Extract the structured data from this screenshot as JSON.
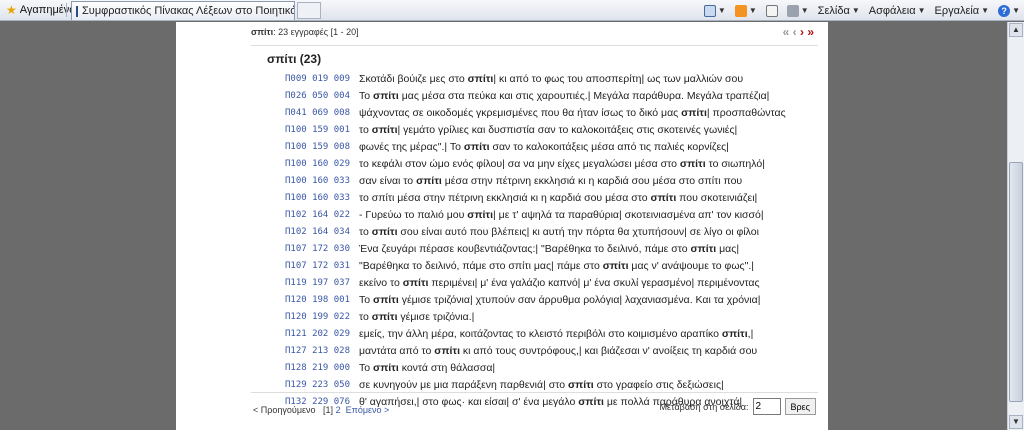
{
  "browser": {
    "favorites_label": "Αγαπημένα",
    "tab_title": "Συμφραστικός Πίνακας Λέξεων στο Ποιητικό Έργο το...",
    "tools": {
      "page": "Σελίδα",
      "safety": "Ασφάλεια",
      "tools": "Εργαλεία"
    }
  },
  "results": {
    "term": "σπίτι",
    "count_text": ": 23 εγγραφές [1 - 20]",
    "heading": "σπίτι (23)",
    "rows": [
      {
        "ref": "Π009 019 009",
        "before": "Σκοτάδι βούιζε μες στο ",
        "word": "σπίτι",
        "after": "| κι από το φως του αποσπερίτη| ως των μαλλιών σου"
      },
      {
        "ref": "Π026 050 004",
        "before": "Το ",
        "word": "σπίτι",
        "after": " μας μέσα στα πεύκα και στις χαρουπιές.| Μεγάλα παράθυρα. Μεγάλα τραπέζια|"
      },
      {
        "ref": "Π041 069 008",
        "before": "ψάχνοντας σε οικοδομές γκρεμισμένες που θα ήταν ίσως το δικό μας ",
        "word": "σπίτι",
        "after": "| προσπαθώντας"
      },
      {
        "ref": "Π100 159 001",
        "before": "το ",
        "word": "σπίτι",
        "after": "| γεμάτο γρίλιες και δυσπιστία σαν το καλοκοιτάξεις στις σκοτεινές γωνιές|"
      },
      {
        "ref": "Π100 159 008",
        "before": "φωνές της μέρας\".| Το ",
        "word": "σπίτι",
        "after": " σαν το καλοκοιτάξεις μέσα από τις παλιές κορνίζες|"
      },
      {
        "ref": "Π100 160 029",
        "before": "το κεφάλι στον ώμο ενός φίλου| σα να μην είχες μεγαλώσει μέσα στο ",
        "word": "σπίτι",
        "after": " το σιωπηλό|"
      },
      {
        "ref": "Π100 160 033",
        "before": "σαν είναι το ",
        "word": "σπίτι",
        "after": " μέσα στην πέτρινη εκκλησιά κι η καρδιά σου μέσα στο σπίτι που"
      },
      {
        "ref": "Π100 160 033",
        "before": "το σπίτι μέσα στην πέτρινη εκκλησιά κι η καρδιά σου μέσα στο ",
        "word": "σπίτι",
        "after": " που σκοτεινιάζει|"
      },
      {
        "ref": "Π102 164 022",
        "before": "- Γυρεύω το παλιό μου ",
        "word": "σπίτι",
        "after": "| με τ' αψηλά τα παραθύρια| σκοτεινιασμένα απ' τον κισσό|"
      },
      {
        "ref": "Π102 164 034",
        "before": "το ",
        "word": "σπίτι",
        "after": " σου είναι αυτό που βλέπεις| κι αυτή την πόρτα θα χτυπήσουν| σε λίγο οι φίλοι"
      },
      {
        "ref": "Π107 172 030",
        "before": "Ένα ζευγάρι πέρασε κουβεντιάζοντας:| \"Βαρέθηκα το δειλινό, πάμε στο ",
        "word": "σπίτι",
        "after": " μας|"
      },
      {
        "ref": "Π107 172 031",
        "before": "\"Βαρέθηκα το δειλινό, πάμε στο σπίτι μας| πάμε στο ",
        "word": "σπίτι",
        "after": " μας ν' ανάψουμε το φως\".|"
      },
      {
        "ref": "Π119 197 037",
        "before": "εκείνο το ",
        "word": "σπίτι",
        "after": " περιμένει| μ' ένα γαλάζιο καπνό| μ' ένα σκυλί γερασμένο| περιμένοντας"
      },
      {
        "ref": "Π120 198 001",
        "before": "Το ",
        "word": "σπίτι",
        "after": " γέμισε τριζόνια| χτυπούν σαν άρρυθμα ρολόγια| λαχανιασμένα. Και τα χρόνια|"
      },
      {
        "ref": "Π120 199 022",
        "before": "το ",
        "word": "σπίτι",
        "after": " γέμισε τριζόνια.|"
      },
      {
        "ref": "Π121 202 029",
        "before": "εμείς, την άλλη μέρα, κοιτάζοντας το κλειστό περιβόλι στο κοιμισμένο αραπίκο ",
        "word": "σπίτι",
        "after": ",|"
      },
      {
        "ref": "Π127 213 028",
        "before": "μαντάτα από το ",
        "word": "σπίτι",
        "after": " κι από τους συντρόφους,| και βιάζεσαι ν' ανοίξεις τη καρδιά σου"
      },
      {
        "ref": "Π128 219 000",
        "before": "Το ",
        "word": "σπίτι",
        "after": " κοντά στη θάλασσα|"
      },
      {
        "ref": "Π129 223 050",
        "before": "σε κυνηγούν με μια παράξενη παρθενιά| στο ",
        "word": "σπίτι",
        "after": " στο γραφείο στις δεξιώσεις|"
      },
      {
        "ref": "Π132 229 076",
        "before": "θ' αγαπήσει,| στο φως· και είσαι| σ' ένα μεγάλο ",
        "word": "σπίτι",
        "after": " με πολλά παράθυρα ανοιχτά|"
      }
    ]
  },
  "pagination": {
    "prev_label": "< Προηγούμενο",
    "current": "[1]",
    "page2": "2",
    "next_label": "Επόμενο >",
    "goto_label": "Μετάβαση στη σελίδα:",
    "goto_value": "2",
    "goto_button": "Βρες"
  }
}
